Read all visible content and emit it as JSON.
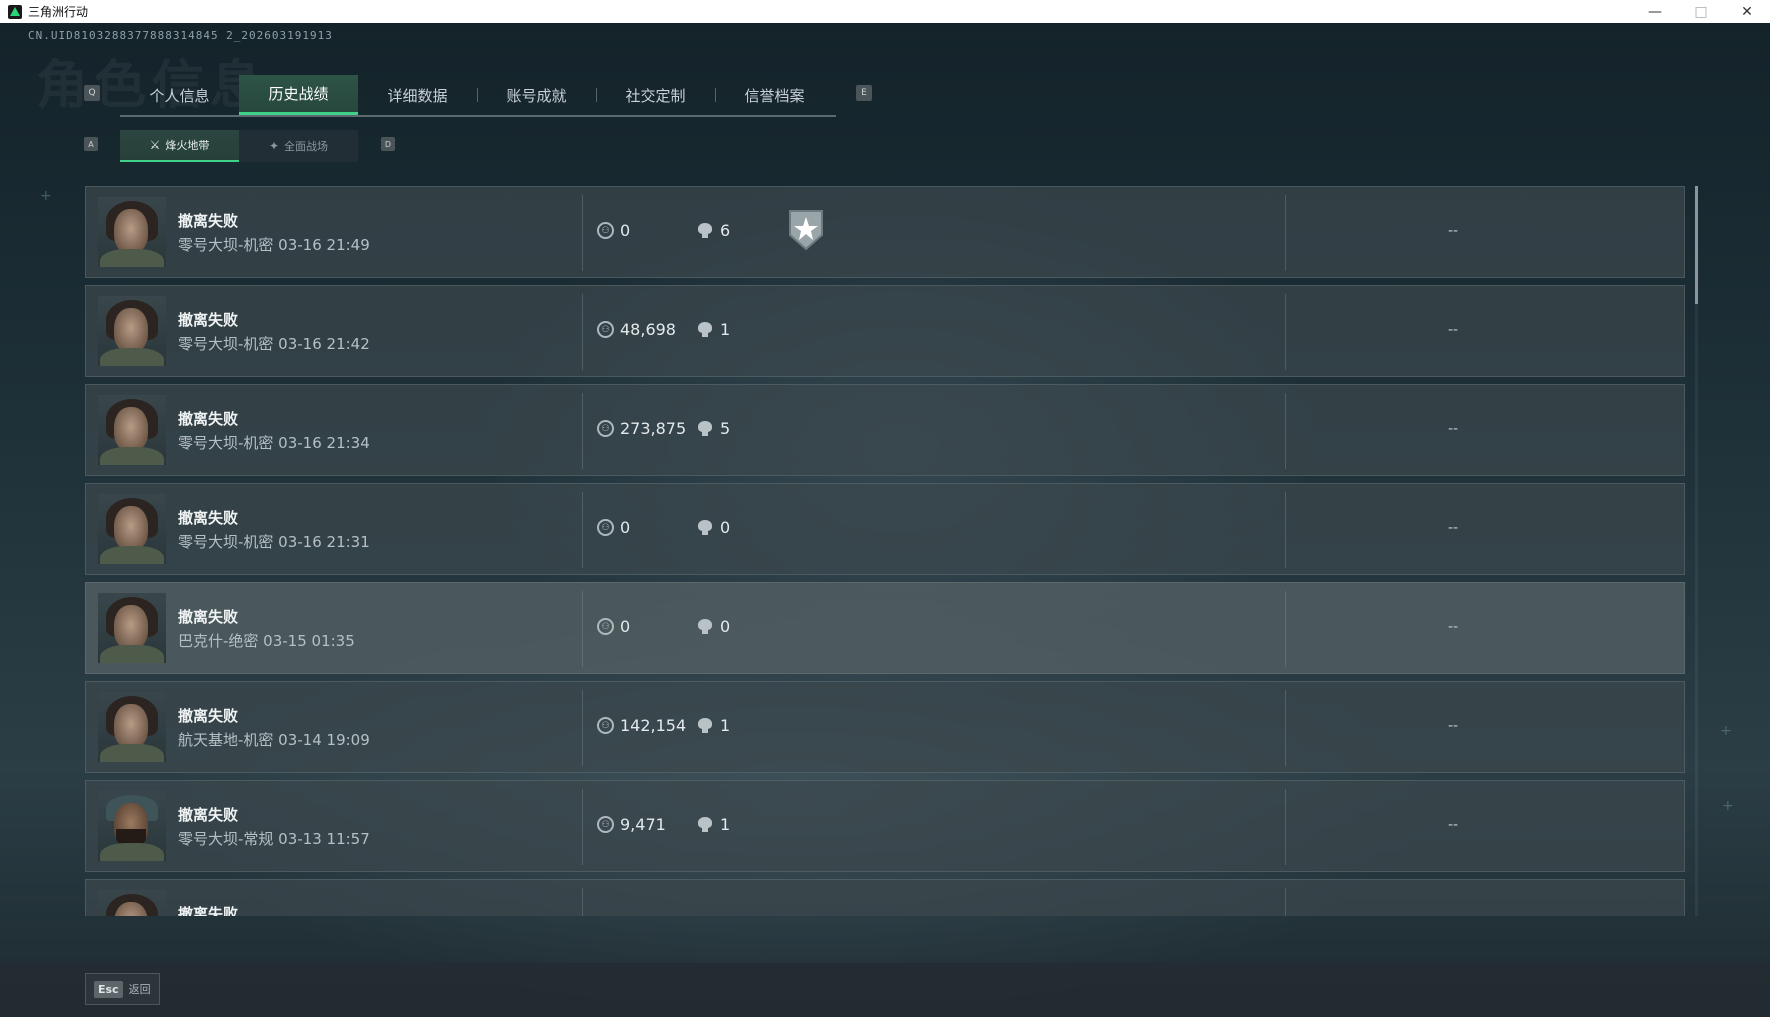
{
  "window": {
    "title": "三角洲行动"
  },
  "header": {
    "uid": "CN.UID8103288377888314845 2_202603191913",
    "watermark": "角色信息",
    "left_key": "Q",
    "right_key": "E"
  },
  "main_tabs": [
    {
      "label": "个人信息",
      "active": false
    },
    {
      "label": "历史战绩",
      "active": true
    },
    {
      "label": "详细数据",
      "active": false
    },
    {
      "label": "账号成就",
      "active": false
    },
    {
      "label": "社交定制",
      "active": false
    },
    {
      "label": "信誉档案",
      "active": false
    }
  ],
  "sub_tabs": {
    "left_key": "A",
    "right_key": "D",
    "items": [
      {
        "label": "烽火地带",
        "icon": "flame-zone-icon",
        "active": true
      },
      {
        "label": "全面战场",
        "icon": "battlefield-icon",
        "active": false
      }
    ]
  },
  "records": [
    {
      "status": "撤离失败",
      "map_time": "零号大坝-机密 03-16 21:49",
      "value": "0",
      "kills": "6",
      "badge": true,
      "result": "--",
      "avatar": "female"
    },
    {
      "status": "撤离失败",
      "map_time": "零号大坝-机密 03-16 21:42",
      "value": "48,698",
      "kills": "1",
      "badge": false,
      "result": "--",
      "avatar": "female"
    },
    {
      "status": "撤离失败",
      "map_time": "零号大坝-机密 03-16 21:34",
      "value": "273,875",
      "kills": "5",
      "badge": false,
      "result": "--",
      "avatar": "female"
    },
    {
      "status": "撤离失败",
      "map_time": "零号大坝-机密 03-16 21:31",
      "value": "0",
      "kills": "0",
      "badge": false,
      "result": "--",
      "avatar": "female"
    },
    {
      "status": "撤离失败",
      "map_time": "巴克什-绝密 03-15 01:35",
      "value": "0",
      "kills": "0",
      "badge": false,
      "result": "--",
      "avatar": "female"
    },
    {
      "status": "撤离失败",
      "map_time": "航天基地-机密 03-14 19:09",
      "value": "142,154",
      "kills": "1",
      "badge": false,
      "result": "--",
      "avatar": "female"
    },
    {
      "status": "撤离失败",
      "map_time": "零号大坝-常规 03-13 11:57",
      "value": "9,471",
      "kills": "1",
      "badge": false,
      "result": "--",
      "avatar": "male"
    },
    {
      "status": "撤离失败",
      "map_time": "",
      "value": "",
      "kills": "",
      "badge": false,
      "result": "",
      "avatar": "female"
    }
  ],
  "bottom": {
    "esc_key": "Esc",
    "esc_label": "返回"
  },
  "colors": {
    "accent": "#3fd08a",
    "row_bg": "#3c484e",
    "text_primary": "#f0f3f4"
  }
}
